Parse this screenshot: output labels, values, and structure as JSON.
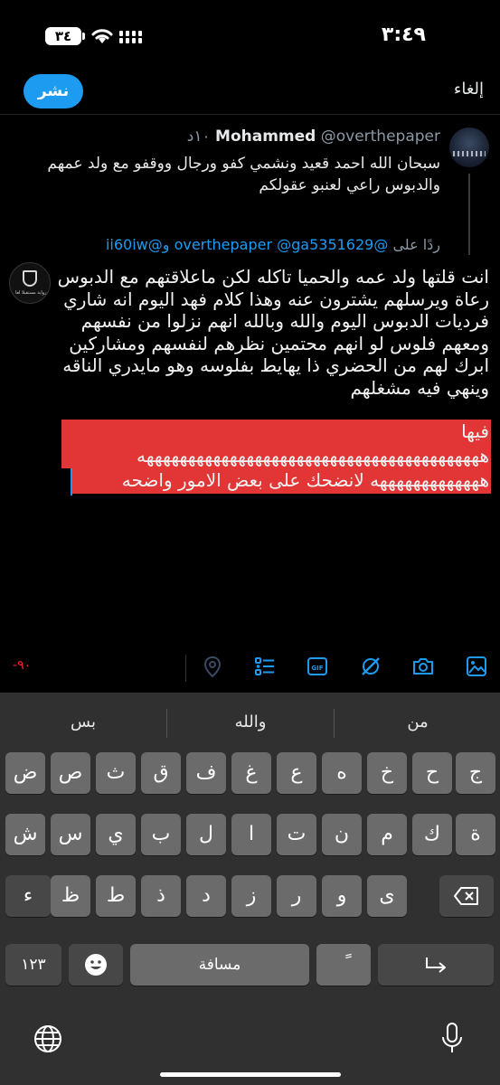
{
  "status_bar": {
    "time": "٣:٤٩",
    "battery": "٣٤"
  },
  "header": {
    "publish_label": "نشر",
    "cancel_label": "إلغاء"
  },
  "original_tweet": {
    "name": "Mohammed",
    "handle": "@overthepaper",
    "time": "١٠د",
    "text": "سبحان الله احمد قعيد ونشمي كفو ورجال ووقفو مع ولد عمهم والدبوس راعي لعنبو عقولكم"
  },
  "reply_to": {
    "prefix": "ردًا على",
    "mentions": "@overthepaper @ga5351629 و@ii60iw"
  },
  "composer": {
    "text": "انت قلتها ولد عمه والحميا تاكله لكن ماعلاقتهم مع الدبوس رعاة ويرسلهم يشترون عنه وهذا كلام فهد اليوم انه شاري فرديات الدبوس اليوم والله وبالله انهم نزلوا من نفسهم ومعهم فلوس لو انهم محتمين نظرهم لنفسهم ومشاركين ابرك لهم من الحضري ذا يهايط بفلوسه وهو مايدري الناقه وينهي فيه مشغلهم",
    "selected_line1": "فيها",
    "selected_line2": "هههههههههههههههههههههههههههههههههههههههههه",
    "selected_line3": "هههههههههههههه لانضحك على بعض الامور واضحه",
    "avatar_text": "رواية مستقبلا لعا"
  },
  "toolbar": {
    "char_counter": "-٩٠",
    "icons": [
      "media-icon",
      "camera-icon",
      "grok-icon",
      "gif-icon",
      "poll-icon",
      "location-icon"
    ]
  },
  "keyboard": {
    "suggestions": [
      "بس",
      "والله",
      "من"
    ],
    "row1": [
      "ض",
      "ص",
      "ث",
      "ق",
      "ف",
      "غ",
      "ع",
      "ه",
      "خ",
      "ح",
      "ج"
    ],
    "row2": [
      "ش",
      "س",
      "ي",
      "ب",
      "ل",
      "ا",
      "ت",
      "ن",
      "م",
      "ك",
      "ة"
    ],
    "row3": [
      "ء",
      "ظ",
      "ط",
      "ذ",
      "د",
      "ز",
      "ر",
      "و",
      "ى"
    ],
    "numbers_key": "١٢٣",
    "space_label": "مسافة",
    "tanween_key": "ً"
  },
  "colors": {
    "accent": "#1d9bf0",
    "selection": "#e23636",
    "counter_warning": "#f4212e",
    "keyboard_bg": "#303030",
    "key_bg": "#6b6b6b"
  }
}
